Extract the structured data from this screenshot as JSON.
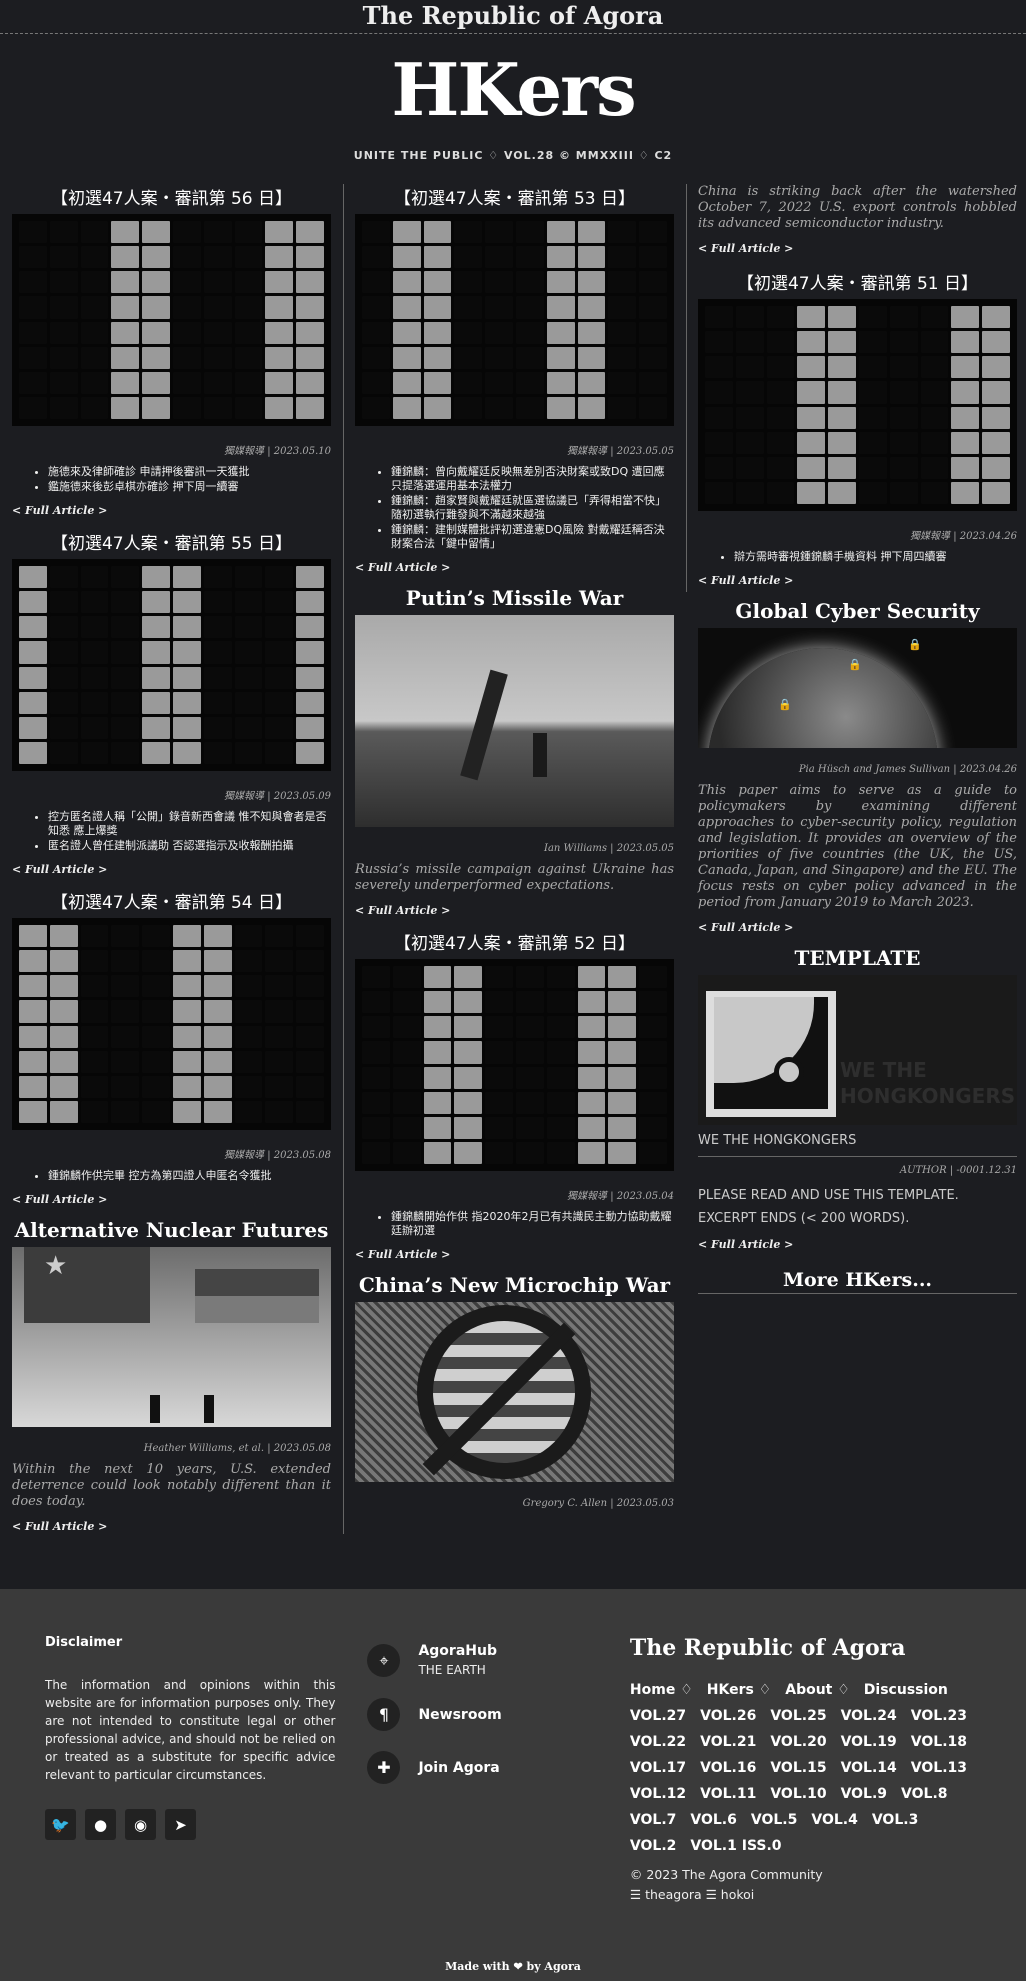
{
  "site": {
    "topbar": "The Republic of Agora",
    "masthead": "HKers",
    "tagline": "UNITE THE PUBLIC ♢ VOL.28 © MMXXIII ♢ C2"
  },
  "read_more": "< Full Article >",
  "articles": {
    "a56": {
      "title": "【初選47人案・審訊第 56 日】",
      "credit": "獨媒報導 | 2023.05.10",
      "bullets": [
        "施德來及律師確診 申請押後審訊一天獲批",
        "鑑施德來後彭卓棋亦確診 押下周一續審"
      ]
    },
    "a55": {
      "title": "【初選47人案・審訊第 55 日】",
      "credit": "獨媒報導 | 2023.05.09",
      "bullets": [
        "控方匿名證人稱「公開」錄音新西會議 惟不知與會者是否知悉 應上爆獎",
        "匿名證人曾任建制派議助 否認選指示及收報酬拍攝"
      ]
    },
    "a54": {
      "title": "【初選47人案・審訊第 54 日】",
      "credit": "獨媒報導 | 2023.05.08",
      "bullets": [
        "鍾錦麟作供完畢 控方為第四證人申匿名令獲批"
      ]
    },
    "nuclear": {
      "title": "Alternative Nuclear Futures",
      "credit": "Heather Williams, et al. | 2023.05.08",
      "abstract": "Within the next 10 years, U.S. extended deterrence could look notably different than it does today."
    },
    "a53": {
      "title": "【初選47人案・審訊第 53 日】",
      "credit": "獨媒報導 | 2023.05.05",
      "bullets": [
        "鍾錦麟：曾向戴耀廷反映無差別否決財案或致DQ 遭回應只提落選運用基本法權力",
        "鍾錦麟：趙家賢與戴耀廷就區選協議已「弄得相當不快」 隨初選執行難發與不滿越來越強",
        "鍾錦麟：建制媒體批評初選違憲DQ風險 對戴耀廷稱否決財案合法「鍵中留情」"
      ]
    },
    "putin": {
      "title": "Putin’s Missile War",
      "credit": "Ian Williams | 2023.05.05",
      "abstract": "Russia’s missile campaign against Ukraine has severely underperformed expectations."
    },
    "a52": {
      "title": "【初選47人案・審訊第 52 日】",
      "credit": "獨媒報導 | 2023.05.04",
      "bullets": [
        "鍾錦麟開始作供 指2020年2月已有共識民主動力協助戴耀廷辦初選"
      ]
    },
    "microchip": {
      "title": "China’s New Microchip War",
      "credit": "Gregory C. Allen | 2023.05.03"
    },
    "china_strike": {
      "abstract": "China is striking back after the watershed October 7, 2022 U.S. export controls hobbled its advanced semiconductor industry."
    },
    "a51": {
      "title": "【初選47人案・審訊第 51 日】",
      "credit": "獨媒報導 | 2023.04.26",
      "bullets": [
        "辯方需時審視鍾錦麟手機資料 押下周四續審"
      ]
    },
    "cyber": {
      "title": "Global Cyber Security",
      "credit": "Pia Hüsch and James Sullivan | 2023.04.26",
      "abstract": "This paper aims to serve as a guide to policymakers by examining different approaches to cyber-security policy, regulation and legislation. It provides an overview of the priorities of five countries (the UK, the US, Canada, Japan, and Singapore) and the EU. The focus rests on cyber policy advanced in the period from January 2019 to March 2023."
    },
    "template": {
      "title": "TEMPLATE",
      "logo_text_1": "WE THE",
      "logo_text_2": "HONGKONGERS",
      "subtitle": "WE THE HONGKONGERS",
      "credit": "AUTHOR | -0001.12.31",
      "body_1": "PLEASE READ AND USE THIS TEMPLATE.",
      "body_2": "EXCERPT ENDS (< 200 WORDS)."
    }
  },
  "more_hkers": "More HKers...",
  "footer": {
    "disclaimer_title": "Disclaimer",
    "disclaimer_text": "The information and opinions within this website are for information purposes only. They are not intended to constitute legal or other professional advice, and should not be relied on or treated as a substitute for specific advice relevant to particular circumstances.",
    "links": [
      {
        "title": "AgoraHub",
        "sub": "THE EARTH"
      },
      {
        "title": "Newsroom",
        "sub": ""
      },
      {
        "title": "Join Agora",
        "sub": ""
      }
    ],
    "brand": "The Republic of Agora",
    "nav_main": [
      "Home ♢",
      "HKers ♢",
      "About ♢",
      "Discussion"
    ],
    "vols": [
      "VOL.27",
      "VOL.26",
      "VOL.25",
      "VOL.24",
      "VOL.23",
      "VOL.22",
      "VOL.21",
      "VOL.20",
      "VOL.19",
      "VOL.18",
      "VOL.17",
      "VOL.16",
      "VOL.15",
      "VOL.14",
      "VOL.13",
      "VOL.12",
      "VOL.11",
      "VOL.10",
      "VOL.9",
      "VOL.8",
      "VOL.7",
      "VOL.6",
      "VOL.5",
      "VOL.4",
      "VOL.3",
      "VOL.2",
      "VOL.1 ISS.0"
    ],
    "copyright": "© 2023 The Agora Community",
    "handles": "☰ theagora ☰ hokoi",
    "made_with": "Made with ❤ by Agora"
  },
  "icons": {
    "social": [
      "twitter-icon",
      "github-icon",
      "reddit-icon",
      "telegram-icon"
    ],
    "links": [
      "map-pin-icon",
      "pilcrow-icon",
      "puzzle-icon"
    ]
  }
}
